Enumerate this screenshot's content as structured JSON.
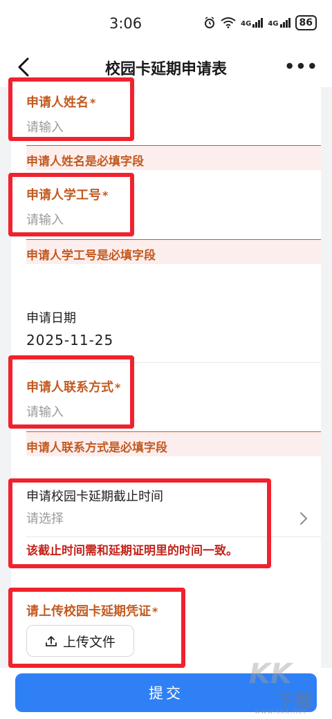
{
  "status_bar": {
    "time": "3:06",
    "network_1": "4G",
    "network_2": "4G",
    "battery": "86"
  },
  "navbar": {
    "title": "校园卡延期申请表",
    "more": "•••"
  },
  "form": {
    "name_field": {
      "label": "申请人姓名",
      "required_mark": "*",
      "placeholder": "请输入",
      "error": "申请人姓名是必填字段"
    },
    "id_field": {
      "label": "申请人学工号",
      "required_mark": "*",
      "placeholder": "请输入",
      "error": "申请人学工号是必填字段"
    },
    "date_field": {
      "label": "申请日期",
      "value": "2025-11-25"
    },
    "contact_field": {
      "label": "申请人联系方式",
      "required_mark": "*",
      "placeholder": "请输入",
      "error": "申请人联系方式是必填字段"
    },
    "deadline_field": {
      "label": "申请校园卡延期截止时间",
      "placeholder": "请选择",
      "hint": "该截止时间需和延期证明里的时间一致。"
    },
    "upload_field": {
      "label": "请上传校园卡延期凭证",
      "required_mark": "*",
      "button_label": "上传文件"
    }
  },
  "submit": {
    "label": "提交"
  },
  "watermark": {
    "logo": "KK",
    "text": "下载",
    "url": "www.kkx.net"
  },
  "colors": {
    "accent_orange": "#c25a20",
    "error_bg": "#fdeeee",
    "warn_red": "#c2241b",
    "primary_blue": "#2f80f5",
    "annotation_red": "#f0222e"
  }
}
